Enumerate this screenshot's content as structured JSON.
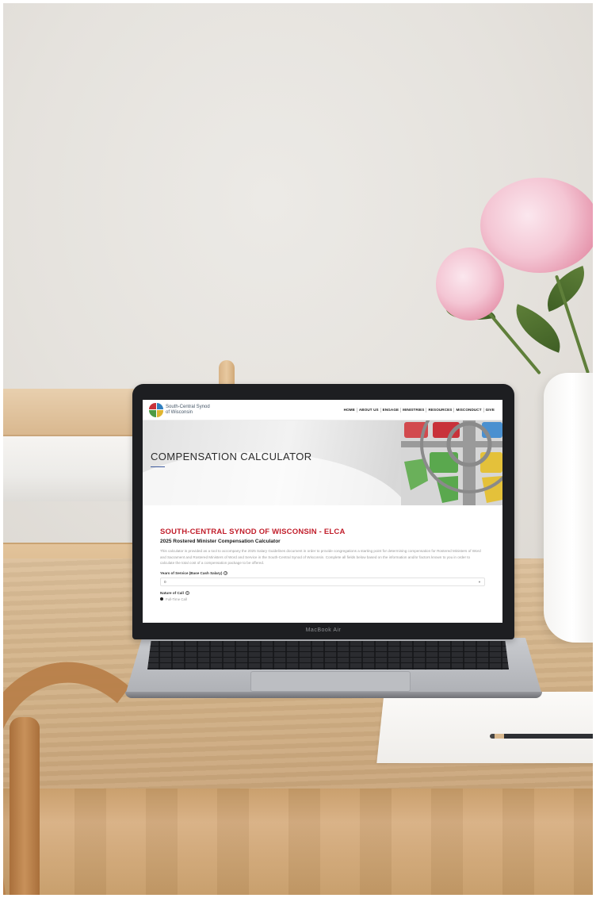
{
  "site": {
    "logo_line1": "South-Central Synod",
    "logo_line2": "of Wisconsin",
    "nav": [
      "HOME",
      "ABOUT US",
      "ENGAGE",
      "MINISTRIES",
      "RESOURCES",
      "MISCONDUCT",
      "GIVE"
    ]
  },
  "hero": {
    "title": "COMPENSATION CALCULATOR"
  },
  "content": {
    "org_title": "SOUTH-CENTRAL SYNOD OF WISCONSIN - ELCA",
    "calc_subtitle": "2025 Rostered Minister Compensation Calculator",
    "intro": "This calculator is provided as a tool to accompany the 2025 Salary Guidelines document in order to provide congregations a starting point for determining compensation for Rostered Ministers of Word and Sacrament and Rostered Ministers of Word and Service in the South-Central Synod of Wisconsin. Complete all fields below based on the information and/or factors known to you in order to calculate the total cost of a compensation package to be offered.",
    "field_years_label": "Years of Service (Base Cash Salary)",
    "field_years_value": "0",
    "field_call_label": "Nature of Call",
    "field_call_option": "Full-Time Call"
  },
  "device": {
    "model_label": "MacBook Air"
  },
  "colors": {
    "accent_red": "#c11d2a",
    "underline_blue": "#3d5a9e"
  }
}
